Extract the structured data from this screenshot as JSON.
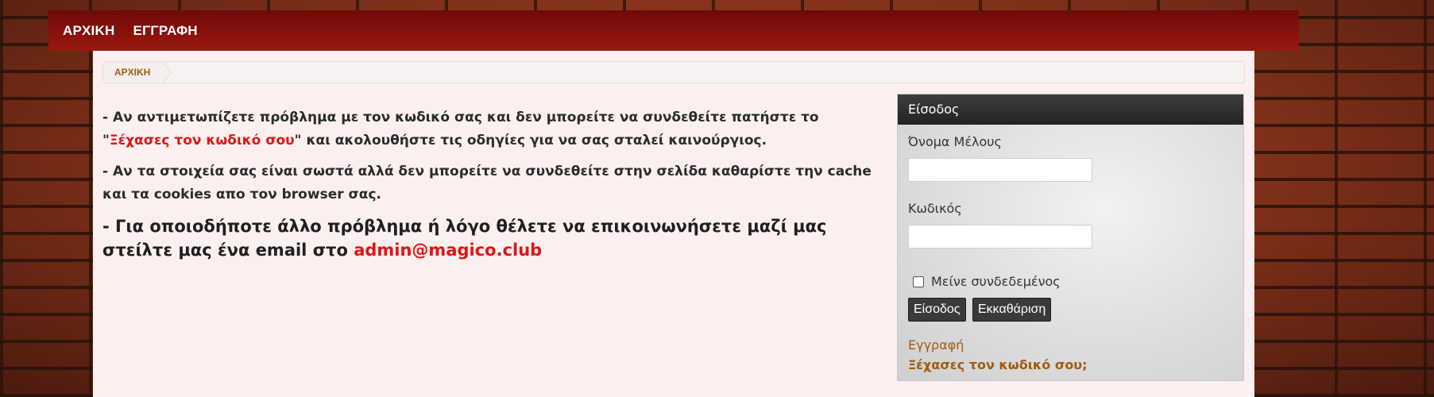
{
  "nav": {
    "items": [
      {
        "label": "ΑΡΧΙΚΗ"
      },
      {
        "label": "ΕΓΓΡΑΦΗ"
      }
    ]
  },
  "breadcrumb": {
    "home": "ΑΡΧΙΚΗ"
  },
  "content": {
    "p1_prefix": " - Αν αντιμετωπίζετε πρόβλημα με τον κωδικό σας και δεν μπορείτε να συνδεθείτε πατήστε το \"",
    "p1_link": "Ξέχασες τον κωδικό σου",
    "p1_suffix": "\" και ακολουθήστε τις οδηγίες για να σας σταλεί καινούργιος.",
    "p2": "- Αν τα στοιχεία σας είναι σωστά αλλά δεν μπορείτε να συνδεθείτε στην σελίδα καθαρίστε την cache και τα cookies απο τον browser σας.",
    "p3_prefix": "- Για οποιοδήποτε άλλο πρόβλημα ή λόγο θέλετε να επικοινωνήσετε μαζί μας στείλτε μας ένα email στο ",
    "p3_email": "admin@magico.club"
  },
  "login": {
    "title": "Είσοδος",
    "username_label": "Όνομα Μέλους",
    "username_value": "",
    "password_label": "Κωδικός",
    "password_value": "",
    "remember_label": "Μείνε συνδεδεμένος",
    "remember_checked": false,
    "submit_label": "Είσοδος",
    "reset_label": "Εκκαθάριση",
    "register_link": "Εγγραφή",
    "forgot_link": "Ξέχασες τον κωδικό σου;"
  },
  "colors": {
    "nav_bg": "#8a120c",
    "link_red": "#e01515",
    "link_brown": "#a25b10",
    "panel_header": "#2e2e2e",
    "button_bg": "#3a3a3a"
  }
}
